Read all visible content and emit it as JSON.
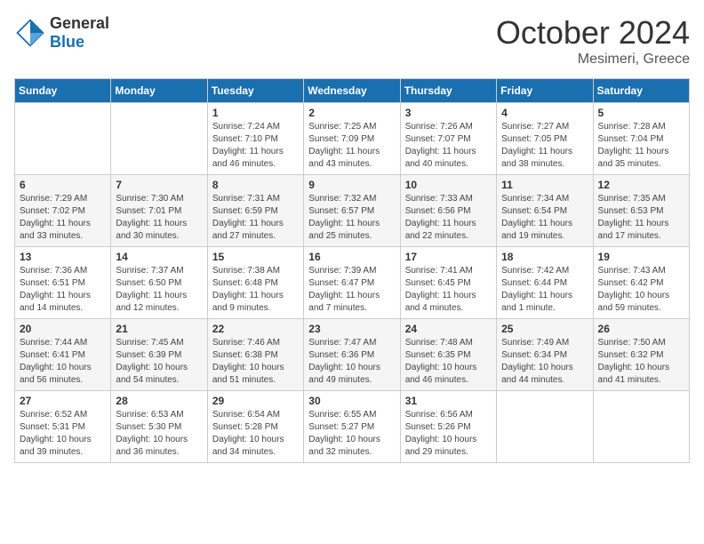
{
  "header": {
    "logo": {
      "general": "General",
      "blue": "Blue"
    },
    "title": "October 2024",
    "location": "Mesimeri, Greece"
  },
  "weekdays": [
    "Sunday",
    "Monday",
    "Tuesday",
    "Wednesday",
    "Thursday",
    "Friday",
    "Saturday"
  ],
  "weeks": [
    [
      {
        "day": null
      },
      {
        "day": null
      },
      {
        "day": 1,
        "sunrise": "7:24 AM",
        "sunset": "7:10 PM",
        "daylight": "11 hours and 46 minutes."
      },
      {
        "day": 2,
        "sunrise": "7:25 AM",
        "sunset": "7:09 PM",
        "daylight": "11 hours and 43 minutes."
      },
      {
        "day": 3,
        "sunrise": "7:26 AM",
        "sunset": "7:07 PM",
        "daylight": "11 hours and 40 minutes."
      },
      {
        "day": 4,
        "sunrise": "7:27 AM",
        "sunset": "7:05 PM",
        "daylight": "11 hours and 38 minutes."
      },
      {
        "day": 5,
        "sunrise": "7:28 AM",
        "sunset": "7:04 PM",
        "daylight": "11 hours and 35 minutes."
      }
    ],
    [
      {
        "day": 6,
        "sunrise": "7:29 AM",
        "sunset": "7:02 PM",
        "daylight": "11 hours and 33 minutes."
      },
      {
        "day": 7,
        "sunrise": "7:30 AM",
        "sunset": "7:01 PM",
        "daylight": "11 hours and 30 minutes."
      },
      {
        "day": 8,
        "sunrise": "7:31 AM",
        "sunset": "6:59 PM",
        "daylight": "11 hours and 27 minutes."
      },
      {
        "day": 9,
        "sunrise": "7:32 AM",
        "sunset": "6:57 PM",
        "daylight": "11 hours and 25 minutes."
      },
      {
        "day": 10,
        "sunrise": "7:33 AM",
        "sunset": "6:56 PM",
        "daylight": "11 hours and 22 minutes."
      },
      {
        "day": 11,
        "sunrise": "7:34 AM",
        "sunset": "6:54 PM",
        "daylight": "11 hours and 19 minutes."
      },
      {
        "day": 12,
        "sunrise": "7:35 AM",
        "sunset": "6:53 PM",
        "daylight": "11 hours and 17 minutes."
      }
    ],
    [
      {
        "day": 13,
        "sunrise": "7:36 AM",
        "sunset": "6:51 PM",
        "daylight": "11 hours and 14 minutes."
      },
      {
        "day": 14,
        "sunrise": "7:37 AM",
        "sunset": "6:50 PM",
        "daylight": "11 hours and 12 minutes."
      },
      {
        "day": 15,
        "sunrise": "7:38 AM",
        "sunset": "6:48 PM",
        "daylight": "11 hours and 9 minutes."
      },
      {
        "day": 16,
        "sunrise": "7:39 AM",
        "sunset": "6:47 PM",
        "daylight": "11 hours and 7 minutes."
      },
      {
        "day": 17,
        "sunrise": "7:41 AM",
        "sunset": "6:45 PM",
        "daylight": "11 hours and 4 minutes."
      },
      {
        "day": 18,
        "sunrise": "7:42 AM",
        "sunset": "6:44 PM",
        "daylight": "11 hours and 1 minute."
      },
      {
        "day": 19,
        "sunrise": "7:43 AM",
        "sunset": "6:42 PM",
        "daylight": "10 hours and 59 minutes."
      }
    ],
    [
      {
        "day": 20,
        "sunrise": "7:44 AM",
        "sunset": "6:41 PM",
        "daylight": "10 hours and 56 minutes."
      },
      {
        "day": 21,
        "sunrise": "7:45 AM",
        "sunset": "6:39 PM",
        "daylight": "10 hours and 54 minutes."
      },
      {
        "day": 22,
        "sunrise": "7:46 AM",
        "sunset": "6:38 PM",
        "daylight": "10 hours and 51 minutes."
      },
      {
        "day": 23,
        "sunrise": "7:47 AM",
        "sunset": "6:36 PM",
        "daylight": "10 hours and 49 minutes."
      },
      {
        "day": 24,
        "sunrise": "7:48 AM",
        "sunset": "6:35 PM",
        "daylight": "10 hours and 46 minutes."
      },
      {
        "day": 25,
        "sunrise": "7:49 AM",
        "sunset": "6:34 PM",
        "daylight": "10 hours and 44 minutes."
      },
      {
        "day": 26,
        "sunrise": "7:50 AM",
        "sunset": "6:32 PM",
        "daylight": "10 hours and 41 minutes."
      }
    ],
    [
      {
        "day": 27,
        "sunrise": "6:52 AM",
        "sunset": "5:31 PM",
        "daylight": "10 hours and 39 minutes."
      },
      {
        "day": 28,
        "sunrise": "6:53 AM",
        "sunset": "5:30 PM",
        "daylight": "10 hours and 36 minutes."
      },
      {
        "day": 29,
        "sunrise": "6:54 AM",
        "sunset": "5:28 PM",
        "daylight": "10 hours and 34 minutes."
      },
      {
        "day": 30,
        "sunrise": "6:55 AM",
        "sunset": "5:27 PM",
        "daylight": "10 hours and 32 minutes."
      },
      {
        "day": 31,
        "sunrise": "6:56 AM",
        "sunset": "5:26 PM",
        "daylight": "10 hours and 29 minutes."
      },
      {
        "day": null
      },
      {
        "day": null
      }
    ]
  ],
  "labels": {
    "sunrise": "Sunrise:",
    "sunset": "Sunset:",
    "daylight": "Daylight:"
  }
}
